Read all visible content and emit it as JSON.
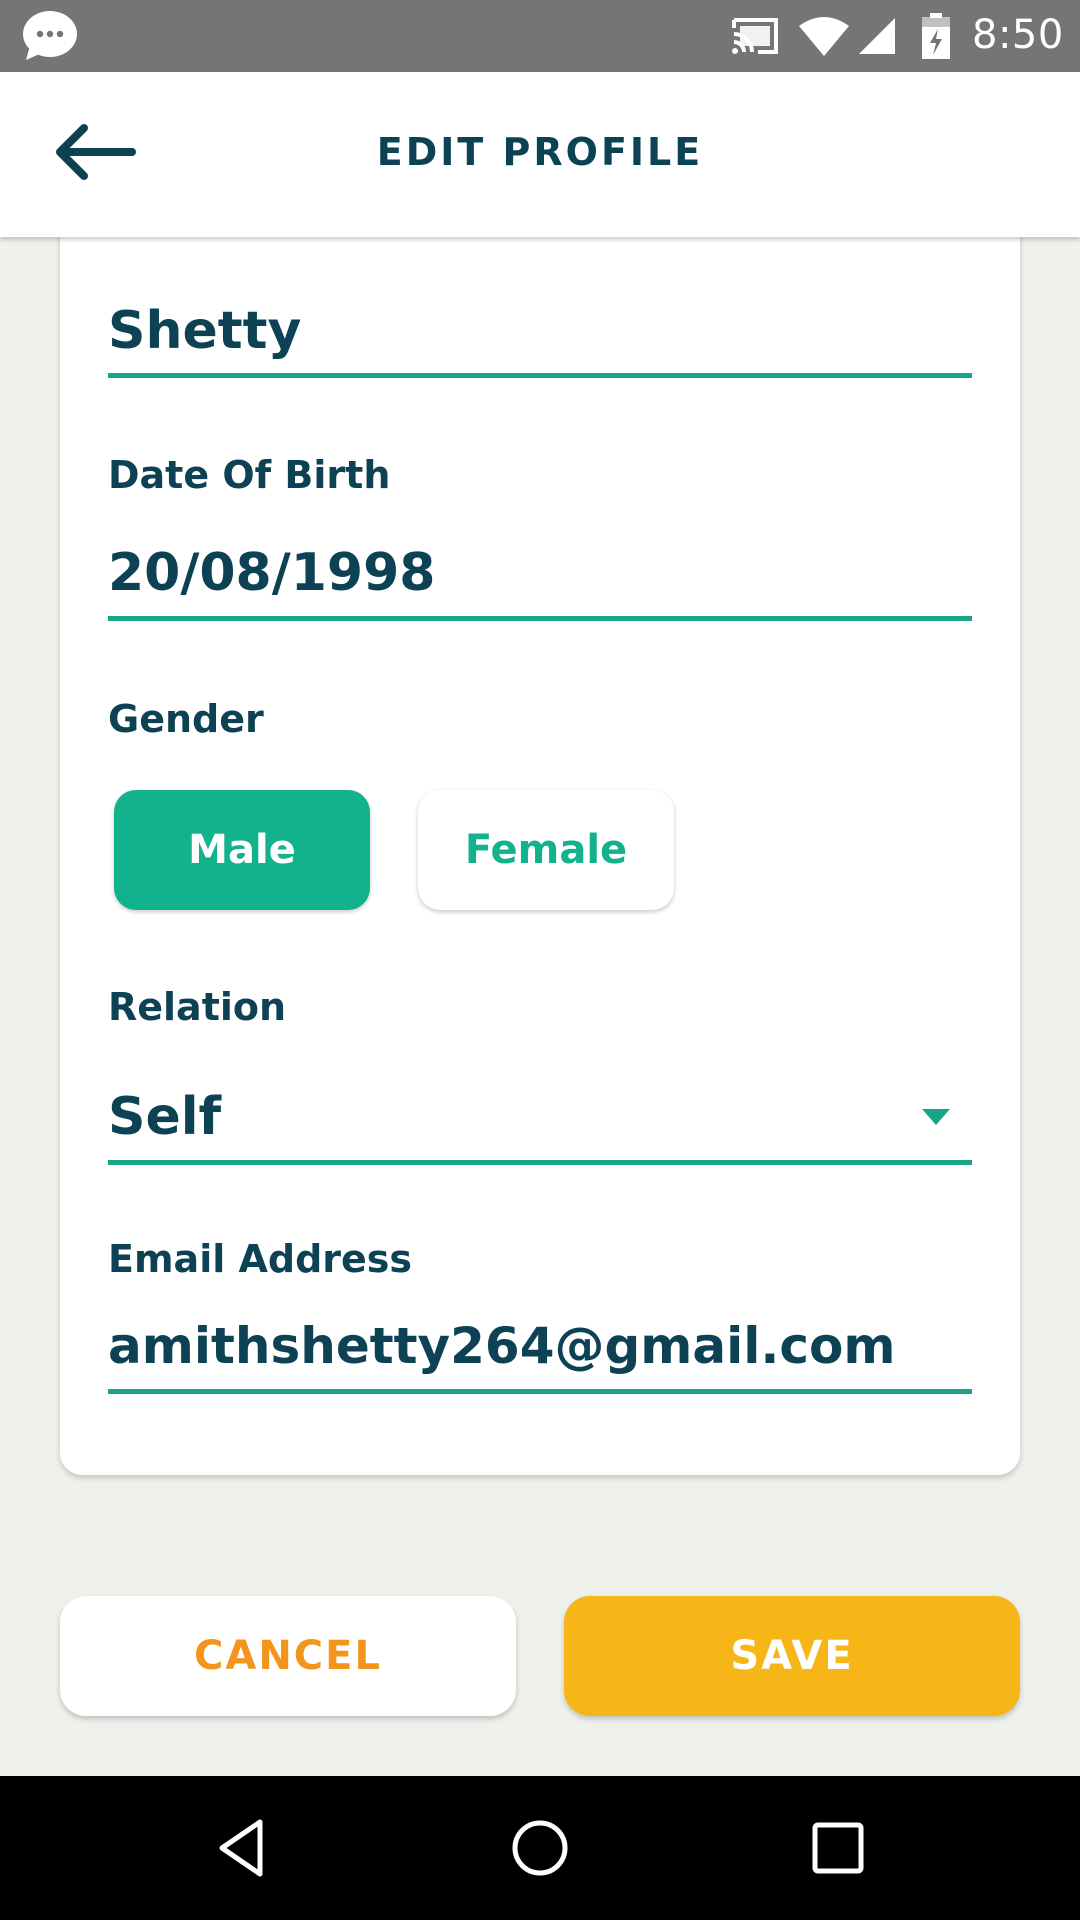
{
  "status_bar": {
    "time": "8:50",
    "icons": [
      "messenger-bubble-icon",
      "cast-icon",
      "wifi-icon",
      "signal-icon",
      "battery-charging-icon"
    ]
  },
  "header": {
    "title": "EDIT PROFILE",
    "back_icon": "arrow-left-icon"
  },
  "form": {
    "last_name": {
      "value": "Shetty"
    },
    "dob": {
      "label": "Date Of Birth",
      "value": "20/08/1998"
    },
    "gender": {
      "label": "Gender",
      "options": [
        "Male",
        "Female"
      ],
      "selected": "Male"
    },
    "relation": {
      "label": "Relation",
      "value": "Self"
    },
    "email": {
      "label": "Email Address",
      "value": "amithshetty264@gmail.com"
    }
  },
  "actions": {
    "cancel_label": "CANCEL",
    "save_label": "SAVE"
  },
  "colors": {
    "accent_teal": "#12b28d",
    "title_navy": "#0d4254",
    "cancel_orange": "#f3941d",
    "save_yellow": "#f7b618",
    "background": "#eef1ec"
  },
  "nav_bar": {
    "icons": [
      "nav-back-icon",
      "nav-home-icon",
      "nav-recents-icon"
    ]
  }
}
